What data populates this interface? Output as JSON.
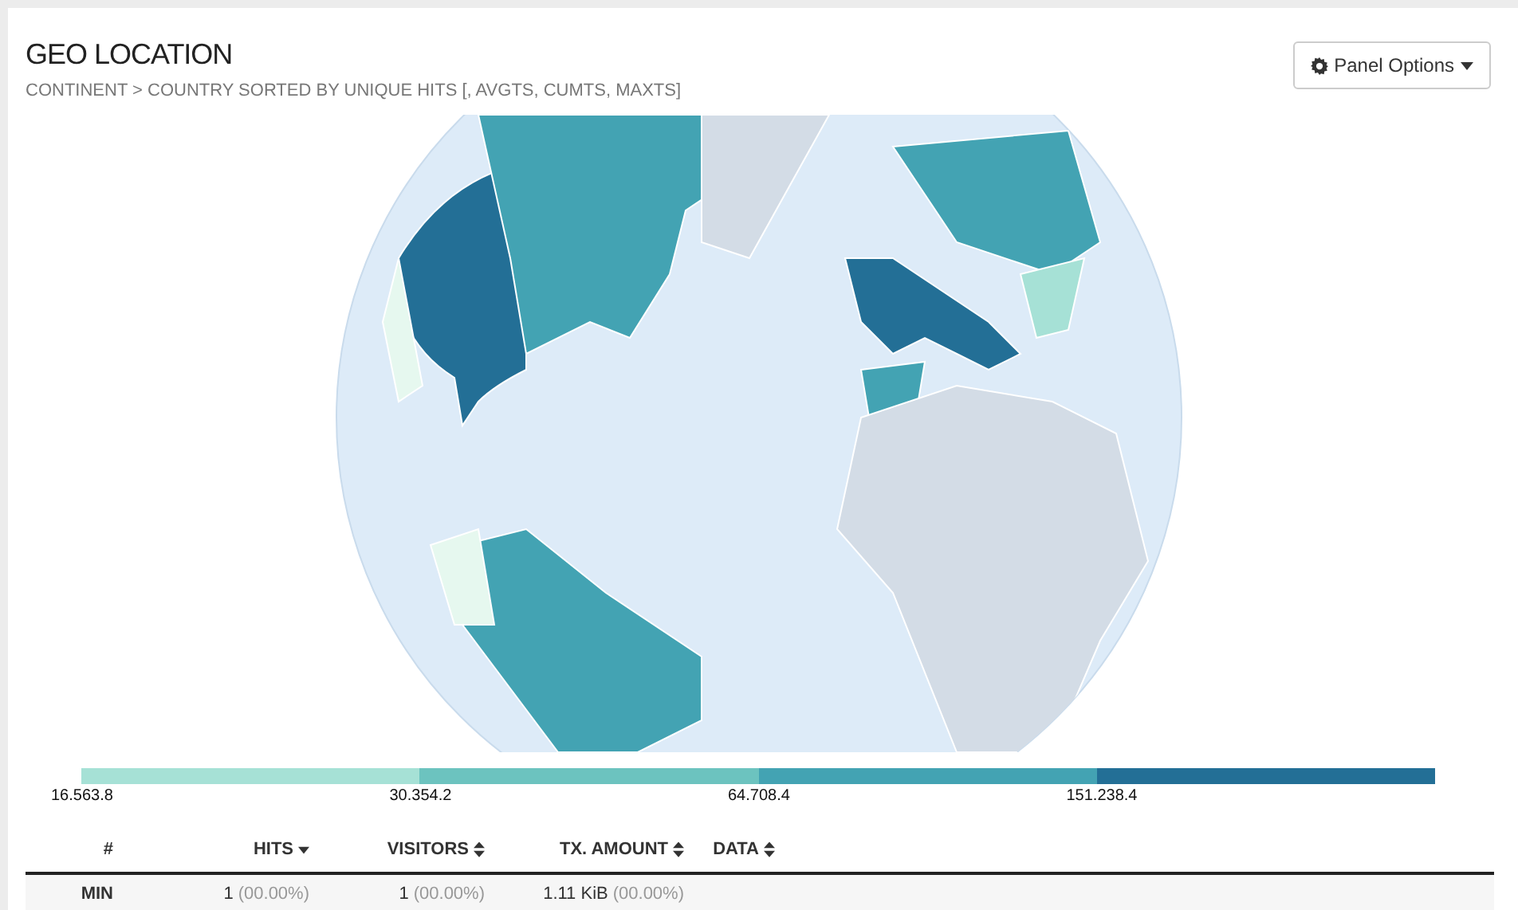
{
  "panel": {
    "title": "GEO LOCATION",
    "subtitle": "CONTINENT > COUNTRY SORTED BY UNIQUE HITS [, AVGTS, CUMTS, MAXTS]",
    "options_button": "Panel Options"
  },
  "legend": [
    {
      "label": "16.563.8",
      "color": "#a6e1d6"
    },
    {
      "label": "30.354.2",
      "color": "#6cc3bf"
    },
    {
      "label": "64.708.4",
      "color": "#43a3b3"
    },
    {
      "label": "151.238.4",
      "color": "#236f96"
    }
  ],
  "table": {
    "columns": [
      {
        "label": "#"
      },
      {
        "label": "HITS",
        "sorted": true
      },
      {
        "label": "VISITORS",
        "sorted": false
      },
      {
        "label": "TX. AMOUNT",
        "sorted": false
      },
      {
        "label": "DATA",
        "sorted": false
      }
    ],
    "rows": [
      {
        "cells": [
          {
            "value": "MIN"
          },
          {
            "value": "1",
            "percent": "(00.00%)"
          },
          {
            "value": "1",
            "percent": "(00.00%)"
          },
          {
            "value": "1.11 KiB",
            "percent": "(00.00%)"
          }
        ]
      }
    ]
  }
}
